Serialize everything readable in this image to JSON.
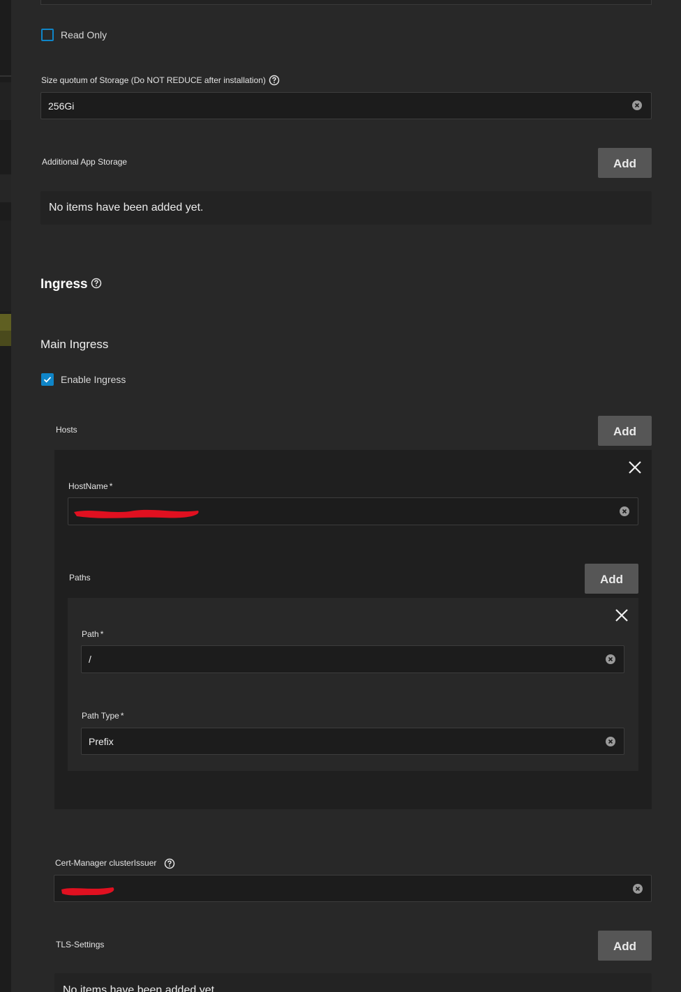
{
  "storage": {
    "read_only_label": "Read Only",
    "size_quota_label": "Size quotum of Storage (Do NOT REDUCE after installation)",
    "size_quota_value": "256Gi",
    "additional_storage_label": "Additional App Storage",
    "add_label": "Add",
    "empty_message": "No items have been added yet."
  },
  "ingress": {
    "title": "Ingress",
    "main_title": "Main Ingress",
    "enable_label": "Enable Ingress",
    "enable_checked": true,
    "hosts_label": "Hosts",
    "add_label": "Add",
    "hostname_label": "HostName",
    "paths_label": "Paths",
    "path_label": "Path",
    "path_value": "/",
    "path_type_label": "Path Type",
    "path_type_value": "Prefix",
    "required_marker": "*",
    "cert_label": "Cert-Manager clusterIssuer",
    "tls_label": "TLS-Settings",
    "empty_message": "No items have been added yet."
  },
  "colors": {
    "accent": "#0f85c8",
    "redaction": "#e01020"
  }
}
